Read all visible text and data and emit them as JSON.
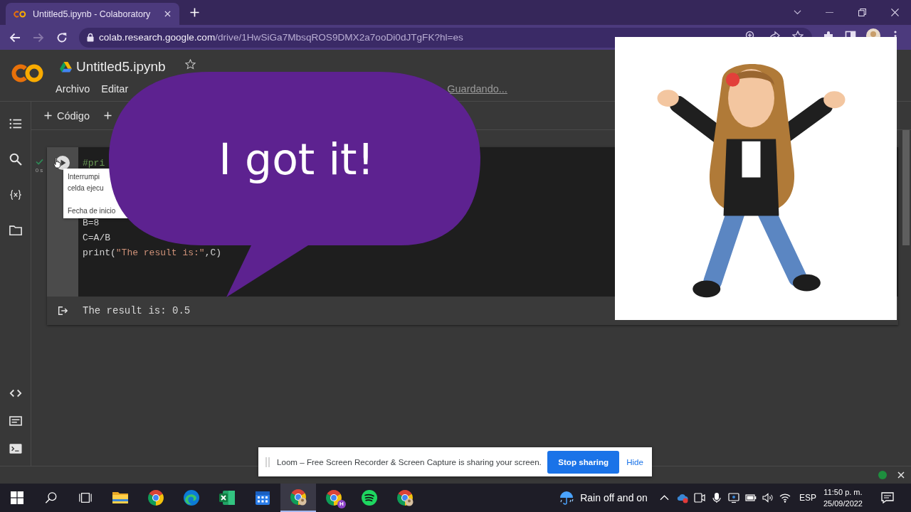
{
  "browser": {
    "tabs": [
      {
        "title": "Untitled5.ipynb - Colaboratory",
        "selected": true
      }
    ],
    "nav": [
      {
        "kind": "back",
        "disabled": false
      },
      {
        "kind": "forward",
        "disabled": true
      },
      {
        "kind": "reload",
        "disabled": false
      }
    ],
    "address": {
      "host": "colab.research.google.com",
      "path": "/drive/1HwSiGa7MbsqROS9DMX2a7ooDi0dJTgFK?hl=es"
    }
  },
  "notebook": {
    "title": "Untitled5.ipynb",
    "menu": [
      "Archivo",
      "Editar"
    ],
    "save_status": "Guardando...",
    "toolbar": [
      {
        "label": "Código"
      }
    ],
    "cell": {
      "executed": true,
      "elapsed": "0 s",
      "code_top": [
        [
          {
            "kind": "comment",
            "text": "#pri"
          }
        ]
      ],
      "code_bottom": [
        [
          {
            "kind": "plain",
            "text": "B=8"
          }
        ],
        [
          {
            "kind": "plain",
            "text": "C=A/B"
          }
        ],
        [
          {
            "kind": "plain",
            "text": "print("
          },
          {
            "kind": "string",
            "text": "\"The result is:\""
          },
          {
            "kind": "plain",
            "text": ",C)"
          }
        ]
      ],
      "tooltip": {
        "lines": [
          "Interrumpi",
          "celda ejecu"
        ],
        "footer": "Fecha de inicio"
      },
      "output": "The result is: 0.5"
    }
  },
  "speech_bubble": {
    "text": "I got it!"
  },
  "loom_bar": {
    "message": "Loom – Free Screen Recorder & Screen Capture is sharing your screen.",
    "button": "Stop sharing",
    "link": "Hide"
  },
  "taskbar": {
    "apps": [
      {
        "kind": "explorer",
        "selected": false
      },
      {
        "kind": "chrome",
        "selected": false
      },
      {
        "kind": "edge",
        "selected": false
      },
      {
        "kind": "excel",
        "selected": false
      },
      {
        "kind": "calendar",
        "selected": false
      },
      {
        "kind": "chrome-profile",
        "selected": true
      },
      {
        "kind": "chrome-badge",
        "badge": "H",
        "selected": false
      },
      {
        "kind": "spotify",
        "selected": false
      },
      {
        "kind": "chrome-profile",
        "selected": false
      }
    ],
    "weather": "Rain off and on",
    "language": "ESP",
    "time": "11:50 p. m.",
    "date": "25/09/2022"
  }
}
